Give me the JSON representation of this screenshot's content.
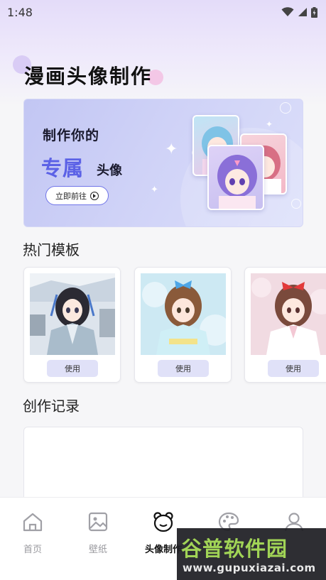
{
  "status_bar": {
    "time": "1:48",
    "icons": [
      "wifi-icon",
      "signal-icon",
      "battery-icon"
    ]
  },
  "page": {
    "title": "漫画头像制作"
  },
  "banner": {
    "line1": "制作你的",
    "line2": "专属",
    "line3": "头像",
    "button_label": "立即前往",
    "accent_color": "#5c62e6"
  },
  "hot_templates": {
    "title": "热门模板",
    "items": [
      {
        "button_label": "使用",
        "scene": "snowy-courtyard"
      },
      {
        "button_label": "使用",
        "scene": "blue-bow"
      },
      {
        "button_label": "使用",
        "scene": "red-ribbon-blossom"
      }
    ]
  },
  "records": {
    "title": "创作记录"
  },
  "tabbar": {
    "items": [
      {
        "label": "首页",
        "icon": "home-icon",
        "active": false
      },
      {
        "label": "壁纸",
        "icon": "image-icon",
        "active": false
      },
      {
        "label": "头像制作",
        "icon": "bear-face-icon",
        "active": true
      },
      {
        "label": "",
        "icon": "palette-icon",
        "active": false
      },
      {
        "label": "",
        "icon": "person-icon",
        "active": false
      }
    ]
  },
  "watermark": {
    "main": "谷普软件园",
    "sub": "www.gupuxiazai.com"
  }
}
